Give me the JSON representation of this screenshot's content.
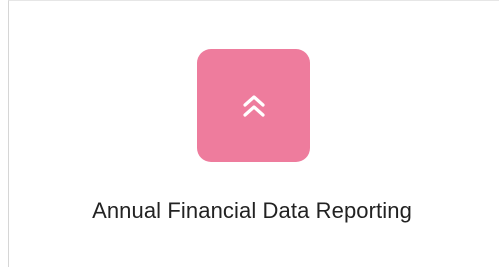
{
  "card": {
    "title": "Annual Financial Data Reporting",
    "icon": "double-chevron-up-icon",
    "colors": {
      "tile": "#ee7c9d",
      "icon": "#ffffff",
      "title": "#222222"
    }
  }
}
